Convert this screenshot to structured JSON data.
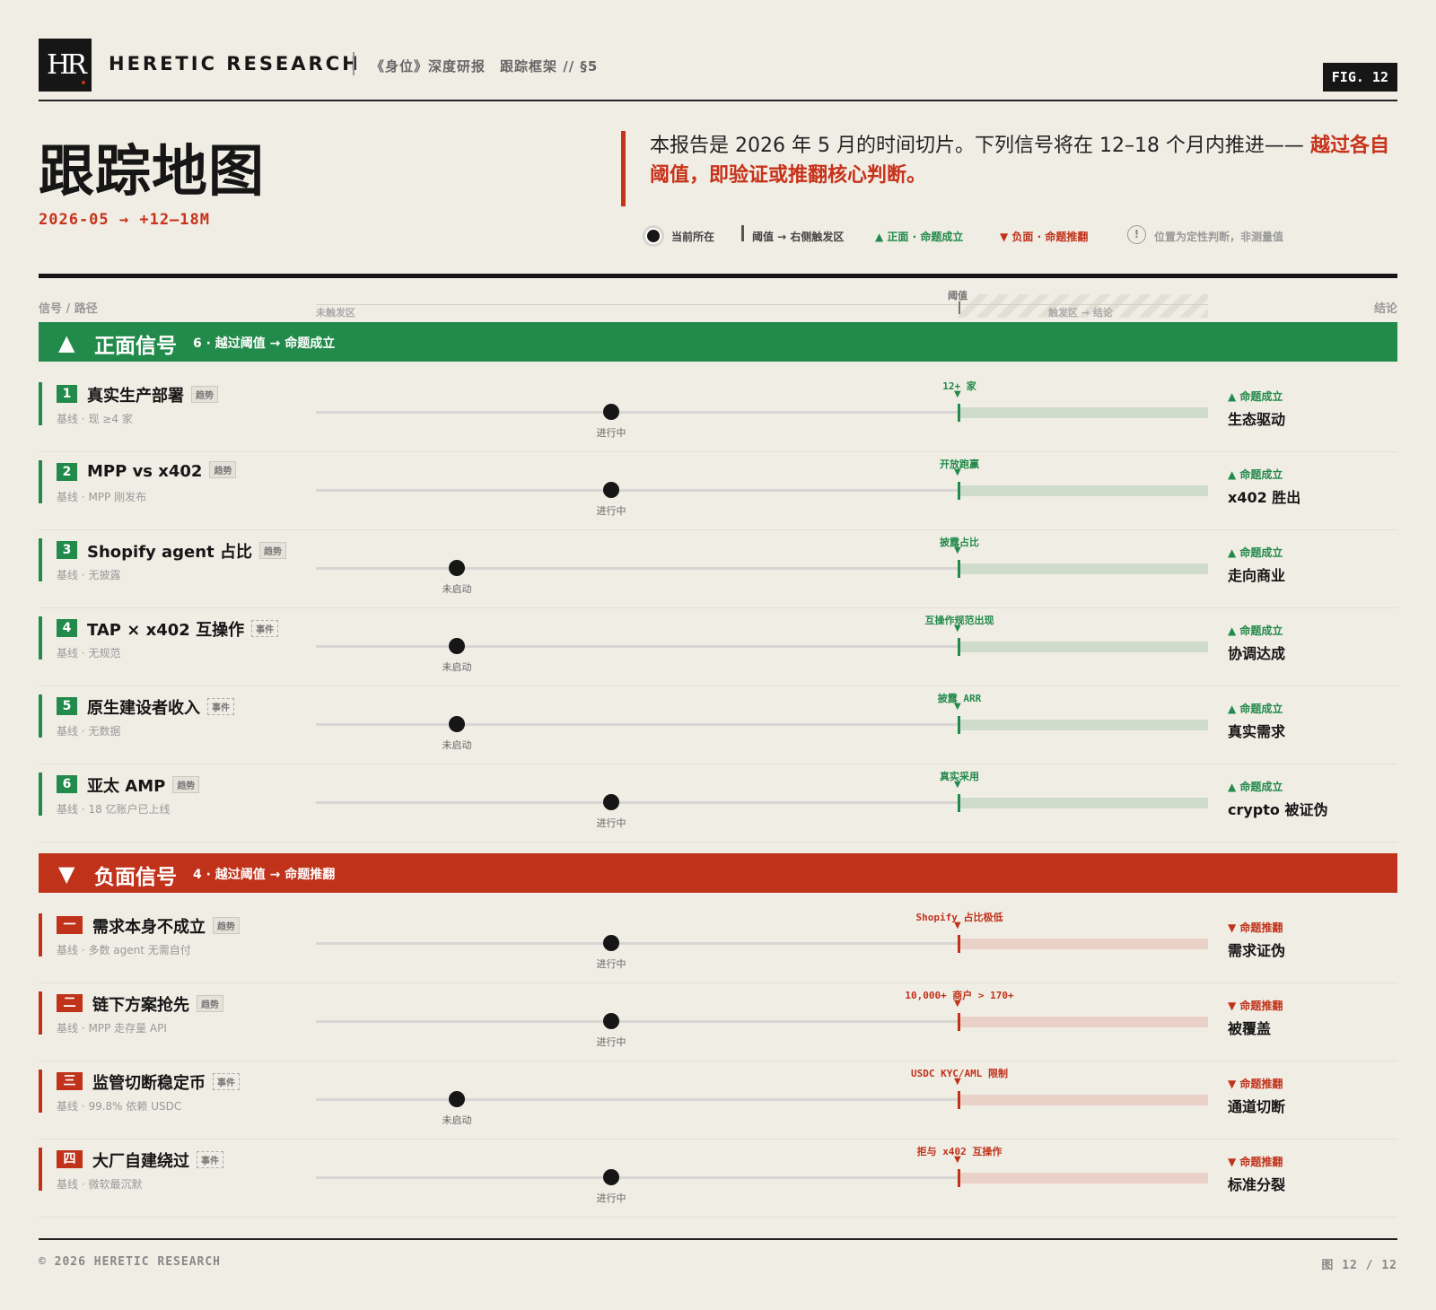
{
  "header": {
    "logo_text": "HR",
    "brand": "HERETIC RESEARCH",
    "crumbs": "《身位》深度研报　跟踪框架 // §5",
    "fig_badge": "FIG. 12"
  },
  "title": "跟踪地图",
  "subtitle": "2026-05 → +12–18M",
  "intro": {
    "text": "本报告是 2026 年 5 月的时间切片。下列信号将在 12–18 个月内推进—— ",
    "highlight": "越过各自阈值，即验证或推翻核心判断。"
  },
  "legend": {
    "current": "当前所在",
    "threshold": "阈值 → 右侧触发区",
    "positive": "▲ 正面 · 命题成立",
    "negative": "▼ 负面 · 命题推翻",
    "note": "位置为定性判断，非测量值"
  },
  "columns": {
    "signal": "信号 / 路径",
    "untriggered": "未触发区",
    "threshold": "阈值",
    "triggered": "触发区 → 结论",
    "conclusion": "结论"
  },
  "positive_section": {
    "name": "正面信号",
    "summary": "6 · 越过阈值 → 命题成立",
    "rows": [
      {
        "num": "1",
        "title": "真实生产部署",
        "tag": "趋势",
        "tag_type": "trend",
        "baseline": "基线 · 现 ≥4 家",
        "threshold": "12+ 家",
        "status": "进行中",
        "progress": 0.46,
        "outcome": "▲ 命题成立",
        "conclusion": "生态驱动"
      },
      {
        "num": "2",
        "title": "MPP vs x402",
        "tag": "趋势",
        "tag_type": "trend",
        "baseline": "基线 · MPP 刚发布",
        "threshold": "开放跑赢",
        "status": "进行中",
        "progress": 0.46,
        "outcome": "▲ 命题成立",
        "conclusion": "x402 胜出"
      },
      {
        "num": "3",
        "title": "Shopify agent 占比",
        "tag": "趋势",
        "tag_type": "trend",
        "baseline": "基线 · 无披露",
        "threshold": "披露占比",
        "status": "未启动",
        "progress": 0.22,
        "outcome": "▲ 命题成立",
        "conclusion": "走向商业"
      },
      {
        "num": "4",
        "title": "TAP × x402 互操作",
        "tag": "事件",
        "tag_type": "event",
        "baseline": "基线 · 无规范",
        "threshold": "互操作规范出现",
        "status": "未启动",
        "progress": 0.22,
        "outcome": "▲ 命题成立",
        "conclusion": "协调达成"
      },
      {
        "num": "5",
        "title": "原生建设者收入",
        "tag": "事件",
        "tag_type": "event",
        "baseline": "基线 · 无数据",
        "threshold": "披露 ARR",
        "status": "未启动",
        "progress": 0.22,
        "outcome": "▲ 命题成立",
        "conclusion": "真实需求"
      },
      {
        "num": "6",
        "title": "亚太 AMP",
        "tag": "趋势",
        "tag_type": "trend",
        "baseline": "基线 · 18 亿账户已上线",
        "threshold": "真实采用",
        "status": "进行中",
        "progress": 0.46,
        "outcome": "▲ 命题成立",
        "conclusion": "crypto 被证伪"
      }
    ]
  },
  "negative_section": {
    "name": "负面信号",
    "summary": "4 · 越过阈值 → 命题推翻",
    "rows": [
      {
        "num": "一",
        "title": "需求本身不成立",
        "tag": "趋势",
        "tag_type": "trend",
        "baseline": "基线 · 多数 agent 无需自付",
        "threshold": "Shopify 占比极低",
        "status": "进行中",
        "progress": 0.46,
        "outcome": "▼ 命题推翻",
        "conclusion": "需求证伪"
      },
      {
        "num": "二",
        "title": "链下方案抢先",
        "tag": "趋势",
        "tag_type": "trend",
        "baseline": "基线 · MPP 走存量 API",
        "threshold": "10,000+ 商户 > 170+",
        "status": "进行中",
        "progress": 0.46,
        "outcome": "▼ 命题推翻",
        "conclusion": "被覆盖"
      },
      {
        "num": "三",
        "title": "监管切断稳定币",
        "tag": "事件",
        "tag_type": "event",
        "baseline": "基线 · 99.8% 依赖 USDC",
        "threshold": "USDC KYC/AML 限制",
        "status": "未启动",
        "progress": 0.22,
        "outcome": "▼ 命题推翻",
        "conclusion": "通道切断"
      },
      {
        "num": "四",
        "title": "大厂自建绕过",
        "tag": "事件",
        "tag_type": "event",
        "baseline": "基线 · 微软最沉默",
        "threshold": "拒与 x402 互操作",
        "status": "进行中",
        "progress": 0.46,
        "outcome": "▼ 命题推翻",
        "conclusion": "标准分裂"
      }
    ]
  },
  "footer": {
    "left": "© 2026 HERETIC RESEARCH",
    "right": "图 12 / 12"
  },
  "colors": {
    "positive": "#228a4a",
    "negative": "#c0321a",
    "ink": "#161616",
    "paper": "#f0ede5"
  }
}
